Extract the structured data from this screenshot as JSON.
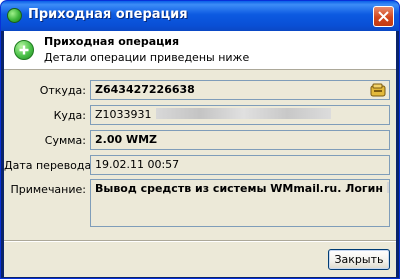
{
  "window": {
    "title": "Приходная операция"
  },
  "header": {
    "title": "Приходная операция",
    "subtitle": "Детали операции приведены ниже"
  },
  "fields": {
    "from_label": "Откуда:",
    "from_value": "Z643427226638",
    "to_label": "Куда:",
    "to_value": "Z1033931",
    "amount_label": "Сумма:",
    "amount_value": "2.00 WMZ",
    "date_label": "Дата перевода:",
    "date_value": "19.02.11 00:57",
    "note_label": "Примечание:",
    "note_value": "Вывод средств из системы WMmail.ru. Логин"
  },
  "buttons": {
    "close_label": "Закрыть"
  },
  "icons": {
    "title": "green-circle-icon",
    "header": "green-plus-icon",
    "wallet": "wallet-icon",
    "close": "close-x-icon"
  },
  "colors": {
    "titlebar": "#0a5fe8",
    "client_bg": "#ece9d8",
    "field_border": "#7f9db9"
  }
}
